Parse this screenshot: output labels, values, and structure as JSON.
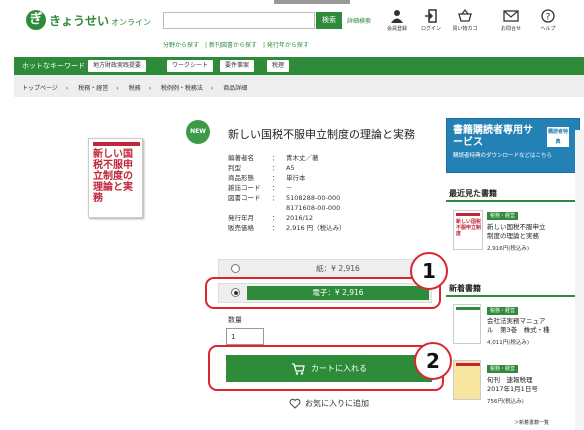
{
  "header": {
    "logo_text": "きょうせい",
    "logo_sub": "オンライン",
    "search_button": "検索",
    "advanced_search": "詳細検索",
    "sublinks": [
      "分野から探す",
      "新刊図書から探す",
      "発行年から探す"
    ],
    "icons": [
      {
        "name": "user-icon",
        "label": "会員登録"
      },
      {
        "name": "login-icon",
        "label": "ログイン"
      },
      {
        "name": "basket-icon",
        "label": "買い物カゴ"
      },
      {
        "name": "mail-icon",
        "label": "お問合せ"
      },
      {
        "name": "help-icon",
        "label": "ヘルプ"
      }
    ]
  },
  "hotbar": {
    "label": "ホットなキーワード",
    "keywords": [
      "地方財政実践提要",
      "ワークシート",
      "要件事案",
      "税理"
    ]
  },
  "breadcrumb": [
    "トップページ",
    "税務・経営",
    "税務",
    "税例例・税務法",
    "商品詳細"
  ],
  "product": {
    "badge": "NEW",
    "title": "新しい国税不服申立制度の理論と実務",
    "cover_title": "新しい国税不服申立制度の理論と実務",
    "details": [
      {
        "key": "編著者名",
        "value": "青木丈／著"
      },
      {
        "key": "判型",
        "value": "A5"
      },
      {
        "key": "商品形態",
        "value": "単行本"
      },
      {
        "key": "雑誌コード",
        "value": "－"
      },
      {
        "key": "図書コード",
        "value": "5108288-00-000"
      },
      {
        "key": "",
        "value": "8171608-00-000"
      },
      {
        "key": "発行年月",
        "value": "2016/12"
      },
      {
        "key": "販売価格",
        "value": "2,916 円（税込み）"
      }
    ],
    "paper_price": "紙：¥ 2,916",
    "electronic_price": "電子：¥ 2,916",
    "quantity_label": "数量",
    "quantity_value": "1",
    "cart_button": "カートに入れる",
    "favorite_button": "お気に入りに追加"
  },
  "callouts": [
    "1",
    "2"
  ],
  "sidebar": {
    "service_title": "書籍購読者専用サービス",
    "service_desc": "購読者特典のダウンロードなどはこちら",
    "service_icon_text": "購読者特典",
    "recent_heading": "最近見た書籍",
    "recent": {
      "tag": "税務・経営",
      "title_l1": "新しい国税不服申立",
      "title_l2": "制度の理論と実務",
      "price": "2,916円(税込み)",
      "cover": "新しい国税不服申立制度"
    },
    "new_heading": "新着書籍",
    "new_items": [
      {
        "tag": "税務・経営",
        "title_l1": "会社法実務マニュア",
        "title_l2": "ル　第3巻　株式・種",
        "price": "4,011円(税込み)"
      },
      {
        "tag": "税務・経営",
        "title_l1": "旬刊　速報税理",
        "title_l2": "2017年1月1日号",
        "price": "756円(税込み)"
      }
    ],
    "more_link": "＞新着書籍一覧"
  },
  "colors": {
    "brand_green": "#2e8b3a",
    "callout_red": "#d9262f",
    "service_blue": "#2481b5"
  }
}
